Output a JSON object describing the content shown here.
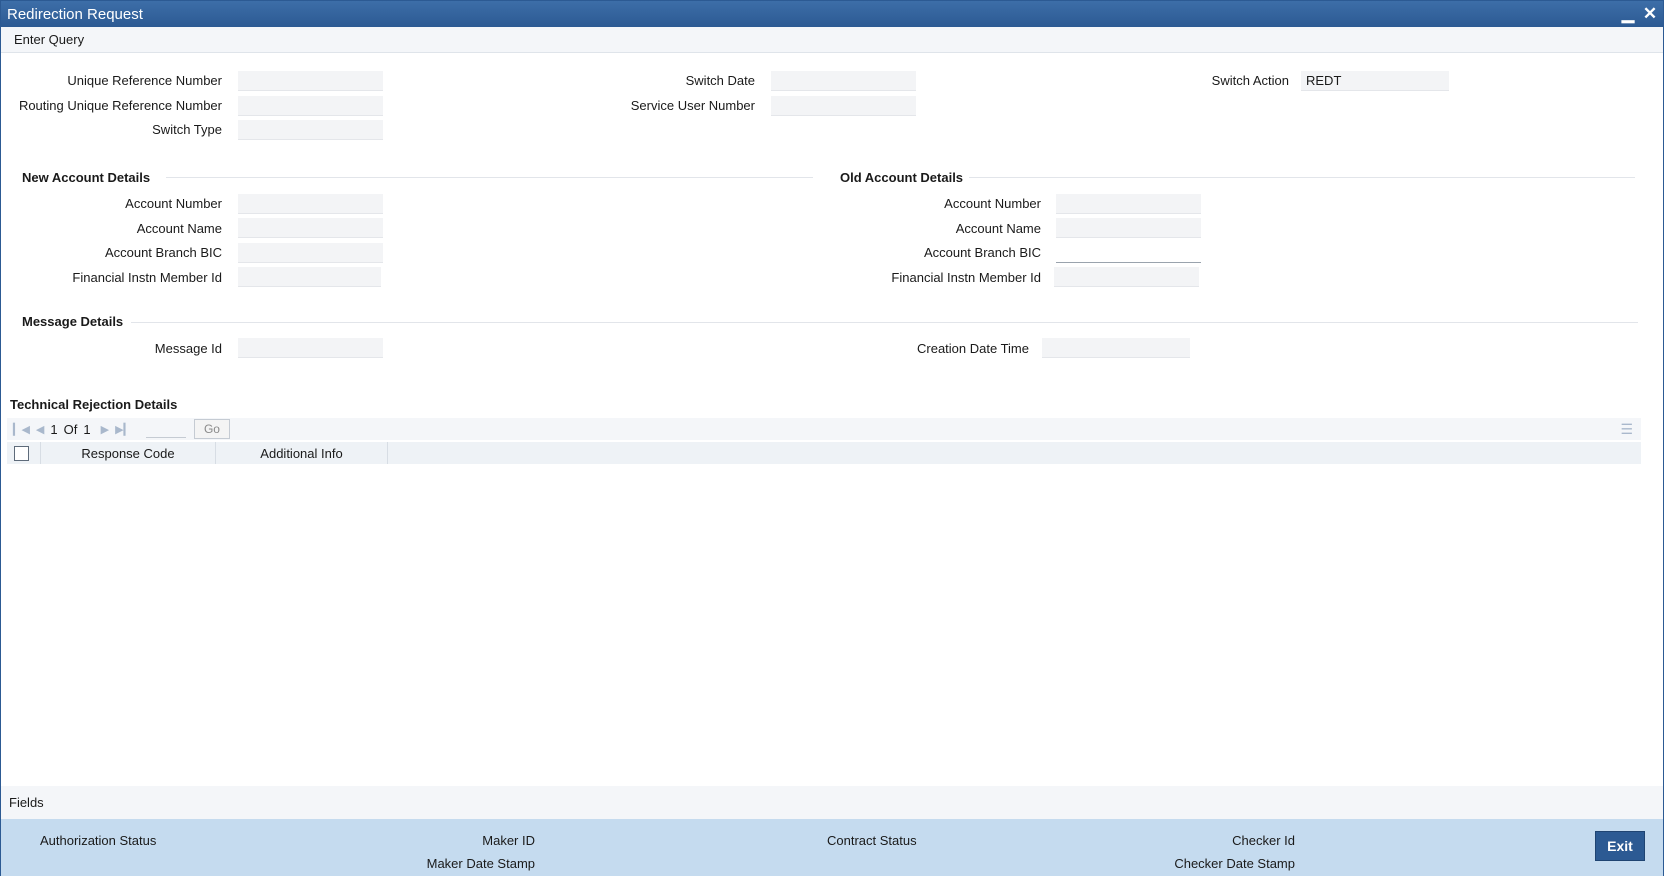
{
  "window": {
    "title": "Redirection Request",
    "minimize_glyph": "▁",
    "close_glyph": "✕"
  },
  "toolbar": {
    "enter_query": "Enter Query"
  },
  "header": {
    "unique_reference_number": {
      "label": "Unique Reference Number",
      "value": ""
    },
    "routing_unique_reference_number": {
      "label": "Routing Unique Reference Number",
      "value": ""
    },
    "switch_type": {
      "label": "Switch Type",
      "value": ""
    },
    "switch_date": {
      "label": "Switch Date",
      "value": ""
    },
    "service_user_number": {
      "label": "Service User Number",
      "value": ""
    },
    "switch_action": {
      "label": "Switch Action",
      "value": "REDT"
    }
  },
  "new_account": {
    "title": "New Account Details",
    "account_number": {
      "label": "Account Number",
      "value": ""
    },
    "account_name": {
      "label": "Account Name",
      "value": ""
    },
    "account_branch_bic": {
      "label": "Account Branch BIC",
      "value": ""
    },
    "financial_instn_member_id": {
      "label": "Financial Instn Member Id",
      "value": ""
    }
  },
  "old_account": {
    "title": "Old Account Details",
    "account_number": {
      "label": "Account Number",
      "value": ""
    },
    "account_name": {
      "label": "Account Name",
      "value": ""
    },
    "account_branch_bic": {
      "label": "Account Branch BIC",
      "value": ""
    },
    "financial_instn_member_id": {
      "label": "Financial Instn Member Id",
      "value": ""
    }
  },
  "message": {
    "title": "Message Details",
    "message_id": {
      "label": "Message Id",
      "value": ""
    },
    "creation_date_time": {
      "label": "Creation Date Time",
      "value": ""
    }
  },
  "rejection_grid": {
    "title": "Technical Rejection Details",
    "page_current": "1",
    "page_of": "Of",
    "page_total": "1",
    "go_label": "Go",
    "columns": [
      "Response Code",
      "Additional Info"
    ],
    "rows": []
  },
  "footer": {
    "fields_label": "Fields",
    "authorization_status": "Authorization Status",
    "maker_id": "Maker ID",
    "maker_date_stamp": "Maker Date Stamp",
    "contract_status": "Contract Status",
    "checker_id": "Checker Id",
    "checker_date_stamp": "Checker Date Stamp",
    "exit_label": "Exit"
  },
  "colors": {
    "titlebar": "#2c5a93",
    "status_bar": "#c5dbef",
    "exit_button": "#2c5a93"
  }
}
